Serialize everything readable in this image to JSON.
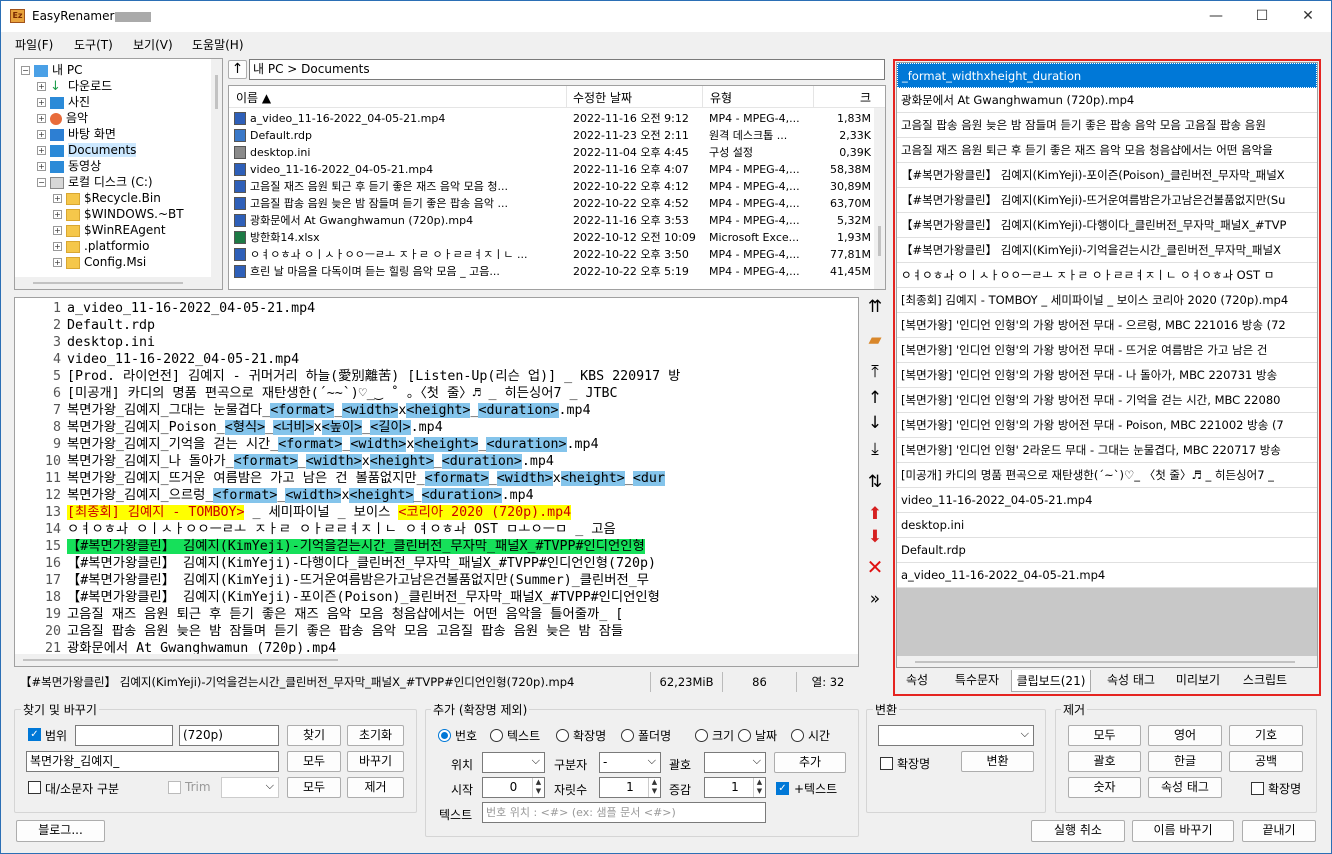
{
  "window": {
    "title": "EasyRenamer",
    "minimize": "—",
    "maximize": "☐",
    "close": "✕"
  },
  "menu": [
    "파일(F)",
    "도구(T)",
    "보기(V)",
    "도움말(H)"
  ],
  "tree": [
    {
      "label": "내 PC",
      "level": 0,
      "expanded": true
    },
    {
      "label": "다운로드",
      "level": 1
    },
    {
      "label": "사진",
      "level": 1
    },
    {
      "label": "음악",
      "level": 1
    },
    {
      "label": "바탕 화면",
      "level": 1
    },
    {
      "label": "Documents",
      "level": 1,
      "selected": true
    },
    {
      "label": "동영상",
      "level": 1
    },
    {
      "label": "로컬 디스크 (C:)",
      "level": 1,
      "expanded": true
    },
    {
      "label": "$Recycle.Bin",
      "level": 2
    },
    {
      "label": "$WINDOWS.~BT",
      "level": 2
    },
    {
      "label": "$WinREAgent",
      "level": 2
    },
    {
      "label": ".platformio",
      "level": 2
    },
    {
      "label": "Config.Msi",
      "level": 2
    }
  ],
  "address": {
    "up": "↑",
    "path": "내 PC > Documents"
  },
  "file_columns": [
    "이름 ▲",
    "수정한 날짜",
    "유형",
    "크"
  ],
  "files": [
    {
      "name": "a_video_11-16-2022_04-05-21.mp4",
      "date": "2022-11-16 오전 9:12",
      "type": "MP4 - MPEG-4,...",
      "size": "1,83M",
      "icon": "mp4"
    },
    {
      "name": "Default.rdp",
      "date": "2022-11-23 오전 2:11",
      "type": "원격 데스크톱 ...",
      "size": "2,33K",
      "icon": "rdp"
    },
    {
      "name": "desktop.ini",
      "date": "2022-11-04 오후 4:45",
      "type": "구성 설정",
      "size": "0,39K",
      "icon": "ini"
    },
    {
      "name": "video_11-16-2022_04-05-21.mp4",
      "date": "2022-11-16 오후 4:07",
      "type": "MP4 - MPEG-4,...",
      "size": "58,38M",
      "icon": "mp4"
    },
    {
      "name": "고음질 재즈 음원 퇴근 후 듣기 좋은 재즈 음악 모음 청...",
      "date": "2022-10-22 오후 4:12",
      "type": "MP4 - MPEG-4,...",
      "size": "30,89M",
      "icon": "mp4"
    },
    {
      "name": "고음질 팝송 음원 늦은 밤 잠들며 듣기 좋은 팝송 음악 ...",
      "date": "2022-10-22 오후 4:52",
      "type": "MP4 - MPEG-4,...",
      "size": "63,70M",
      "icon": "mp4"
    },
    {
      "name": "광화문에서 At Gwanghwamun (720p).mp4",
      "date": "2022-11-16 오후 3:53",
      "type": "MP4 - MPEG-4,...",
      "size": "5,32M",
      "icon": "mp4"
    },
    {
      "name": "방한화14.xlsx",
      "date": "2022-10-12 오전 10:09",
      "type": "Microsoft Exce...",
      "size": "1,93M",
      "icon": "xlsx"
    },
    {
      "name": "ㅇㅕㅇㅎㅘ ㅇㅣㅅㅏㅇㅇㅡㄹㅗ ㅈㅏㄹ ㅇㅏㄹㄹㅕㅈㅣㄴ ...",
      "date": "2022-10-22 오후 3:50",
      "type": "MP4 - MPEG-4,...",
      "size": "77,81M",
      "icon": "mp4"
    },
    {
      "name": "흐린 날 마음을 다독이며 듣는 힐링 음악 모음 _ 고음...",
      "date": "2022-10-22 오후 5:19",
      "type": "MP4 - MPEG-4,...",
      "size": "41,45M",
      "icon": "mp4"
    }
  ],
  "editor": [
    {
      "n": "1",
      "segs": [
        {
          "t": "a_video_11-16-2022_04-05-21.mp4",
          "h": ""
        }
      ]
    },
    {
      "n": "2",
      "segs": [
        {
          "t": "Default.rdp",
          "h": ""
        }
      ]
    },
    {
      "n": "3",
      "segs": [
        {
          "t": "desktop.ini",
          "h": ""
        }
      ]
    },
    {
      "n": "4",
      "segs": [
        {
          "t": "video_11-16-2022_04-05-21.mp4",
          "h": ""
        }
      ]
    },
    {
      "n": "5",
      "segs": [
        {
          "t": "[Prod. 라이언전] 김예지 - 귀머거리 하늘(愛別離苦) [Listen-Up(리슨 업)] _ KBS 220917 방",
          "h": ""
        }
      ]
    },
    {
      "n": "6",
      "segs": [
        {
          "t": "[미공개] 카디의 명품 편곡으로 재탄생한(´~~`)♡_‿ ˚ 。〈첫 줄〉♬ _ 히든싱어7 _ JTBC",
          "h": ""
        }
      ]
    },
    {
      "n": "7",
      "segs": [
        {
          "t": "복면가왕_김예지_그대는 눈물겹다_",
          "h": ""
        },
        {
          "t": "<format>",
          "h": "blue"
        },
        {
          "t": "_",
          "h": ""
        },
        {
          "t": "<width>",
          "h": "blue"
        },
        {
          "t": "x",
          "h": ""
        },
        {
          "t": "<height>",
          "h": "blue"
        },
        {
          "t": "_",
          "h": ""
        },
        {
          "t": "<duration>",
          "h": "blue"
        },
        {
          "t": ".mp4",
          "h": ""
        }
      ]
    },
    {
      "n": "8",
      "segs": [
        {
          "t": "복면가왕_김예지_Poison_",
          "h": ""
        },
        {
          "t": "<형식>",
          "h": "blue"
        },
        {
          "t": "_",
          "h": ""
        },
        {
          "t": "<너비>",
          "h": "blue"
        },
        {
          "t": "x",
          "h": ""
        },
        {
          "t": "<높이>",
          "h": "blue"
        },
        {
          "t": "_",
          "h": ""
        },
        {
          "t": "<길이>",
          "h": "blue"
        },
        {
          "t": ".mp4",
          "h": ""
        }
      ]
    },
    {
      "n": "9",
      "segs": [
        {
          "t": "복면가왕_김예지_기억을 걷는 시간_",
          "h": ""
        },
        {
          "t": "<format>",
          "h": "blue"
        },
        {
          "t": "_",
          "h": ""
        },
        {
          "t": "<width>",
          "h": "blue"
        },
        {
          "t": "x",
          "h": ""
        },
        {
          "t": "<height>",
          "h": "blue"
        },
        {
          "t": "_",
          "h": ""
        },
        {
          "t": "<duration>",
          "h": "blue"
        },
        {
          "t": ".mp4",
          "h": ""
        }
      ]
    },
    {
      "n": "10",
      "segs": [
        {
          "t": "복면가왕_김예지_나 돌아가_",
          "h": ""
        },
        {
          "t": "<format>",
          "h": "blue"
        },
        {
          "t": "_",
          "h": ""
        },
        {
          "t": "<width>",
          "h": "blue"
        },
        {
          "t": "x",
          "h": ""
        },
        {
          "t": "<height>",
          "h": "blue"
        },
        {
          "t": "_",
          "h": ""
        },
        {
          "t": "<duration>",
          "h": "blue"
        },
        {
          "t": ".mp4",
          "h": ""
        }
      ]
    },
    {
      "n": "11",
      "segs": [
        {
          "t": "복면가왕_김예지_뜨거운 여름밤은 가고 남은 건 볼품없지만_",
          "h": ""
        },
        {
          "t": "<format>",
          "h": "blue"
        },
        {
          "t": "_",
          "h": ""
        },
        {
          "t": "<width>",
          "h": "blue"
        },
        {
          "t": "x",
          "h": ""
        },
        {
          "t": "<height>",
          "h": "blue"
        },
        {
          "t": "_",
          "h": ""
        },
        {
          "t": "<dur",
          "h": "blue"
        }
      ]
    },
    {
      "n": "12",
      "segs": [
        {
          "t": "복면가왕_김예지_으르렁_",
          "h": ""
        },
        {
          "t": "<format>",
          "h": "blue"
        },
        {
          "t": "_",
          "h": ""
        },
        {
          "t": "<width>",
          "h": "blue"
        },
        {
          "t": "x",
          "h": ""
        },
        {
          "t": "<height>",
          "h": "blue"
        },
        {
          "t": "_",
          "h": ""
        },
        {
          "t": "<duration>",
          "h": "blue"
        },
        {
          "t": ".mp4",
          "h": ""
        }
      ]
    },
    {
      "n": "13",
      "segs": [
        {
          "t": "[최종회] 김예지 - TOMBOY>",
          "h": "yellow"
        },
        {
          "t": " _ 세미파이널 _ 보이스 ",
          "h": ""
        },
        {
          "t": "<코리아 2020 (720p).mp4",
          "h": "yellow"
        }
      ]
    },
    {
      "n": "14",
      "segs": [
        {
          "t": "ㅇㅕㅇㅎㅘ ㅇㅣㅅㅏㅇㅇㅡㄹㅗ ㅈㅏㄹ ㅇㅏㄹㄹㅕㅈㅣㄴ ㅇㅕㅇㅎㅘ OST ㅁㅗㅇㅡㅁ _ 고음",
          "h": ""
        }
      ]
    },
    {
      "n": "15",
      "segs": [
        {
          "t": "【#복면가왕클린】 김예지(KimYeji)-기억을걷는시간_클린버전_무자막_패널X_#TVPP#인디언인형",
          "h": "green"
        }
      ]
    },
    {
      "n": "16",
      "segs": [
        {
          "t": "【#복면가왕클린】 김예지(KimYeji)-다행이다_클린버전_무자막_패널X_#TVPP#인디언인형(720p)",
          "h": ""
        }
      ]
    },
    {
      "n": "17",
      "segs": [
        {
          "t": "【#복면가왕클린】 김예지(KimYeji)-뜨거운여름밤은가고남은건볼품없지만(Summer)_클린버전_무",
          "h": ""
        }
      ]
    },
    {
      "n": "18",
      "segs": [
        {
          "t": "【#복면가왕클린】 김예지(KimYeji)-포이즌(Poison)_클린버전_무자막_패널X_#TVPP#인디언인형",
          "h": ""
        }
      ]
    },
    {
      "n": "19",
      "segs": [
        {
          "t": "고음질 재즈 음원 퇴근 후 듣기 좋은 재즈 음악 모음 청음샵에서는 어떤 음악을 틀어줄까_ [",
          "h": ""
        }
      ]
    },
    {
      "n": "20",
      "segs": [
        {
          "t": "고음질 팝송 음원 늦은 밤 잠들며 듣기 좋은 팝송 음악 모음 고음질 팝송 음원 늦은 밤 잠들",
          "h": ""
        }
      ]
    },
    {
      "n": "21",
      "segs": [
        {
          "t": "광화문에서 At Gwanghwamun (720p).mp4",
          "h": ""
        }
      ]
    }
  ],
  "status": {
    "filename": "【#복면가왕클린】 김예지(KimYeji)-기억을걷는시간_클린버전_무자막_패널X_#TVPP#인디언인형(720p).mp4",
    "size": "62,23MiB",
    "count": "86",
    "col": "열: 32"
  },
  "right_list": [
    "_format_widthxheight_duration",
    "광화문에서 At Gwanghwamun (720p).mp4",
    "고음질 팝송 음원 늦은 밤 잠들며 듣기 좋은 팝송 음악 모음 고음질 팝송 음원",
    "고음질 재즈 음원 퇴근 후 듣기 좋은 재즈 음악 모음 청음샵에서는 어떤 음악을",
    "【#복면가왕클린】 김예지(KimYeji)-포이즌(Poison)_클린버전_무자막_패널X",
    "【#복면가왕클린】 김예지(KimYeji)-뜨거운여름밤은가고남은건볼품없지만(Su",
    "【#복면가왕클린】 김예지(KimYeji)-다행이다_클린버전_무자막_패널X_#TVP",
    "【#복면가왕클린】 김예지(KimYeji)-기억을걷는시간_클린버전_무자막_패널X",
    "ㅇㅕㅇㅎㅘ ㅇㅣㅅㅏㅇㅇㅡㄹㅗ ㅈㅏㄹ ㅇㅏㄹㄹㅕㅈㅣㄴ ㅇㅕㅇㅎㅘ OST ㅁ",
    "[최종회] 김예지 - TOMBOY _ 세미파이널 _ 보이스 코리아 2020 (720p).mp4",
    "[복면가왕] '인디언 인형'의 가왕 방어전 무대 - 으르렁, MBC 221016 방송 (72",
    "[복면가왕] '인디언 인형'의 가왕 방어전 무대 - 뜨거운 여름밤은 가고 남은 건",
    "[복면가왕] '인디언 인형'의 가왕 방어전 무대 - 나 돌아가, MBC 220731 방송",
    "[복면가왕] '인디언 인형'의 가왕 방어전 무대 - 기억을 걷는 시간, MBC 22080",
    "[복면가왕] '인디언 인형'의 가왕 방어전 무대 - Poison, MBC 221002 방송 (7",
    "[복면가왕] '인디언 인형' 2라운드 무대 - 그대는 눈물겹다, MBC 220717 방송",
    "[미공개] 카디의 명품 편곡으로 재탄생한(´~`)♡_ 〈첫 줄〉♬ _ 히든싱어7 _",
    "video_11-16-2022_04-05-21.mp4",
    "desktop.ini",
    "Default.rdp",
    "a_video_11-16-2022_04-05-21.mp4"
  ],
  "tabs": [
    "속성",
    "특수문자",
    "클립보드(21)",
    "속성 태그",
    "미리보기",
    "스크립트"
  ],
  "find": {
    "title": "찾기 및 바꾸기",
    "range_label": "범위",
    "range_value": "(720p)",
    "find_btn": "찾기",
    "reset_btn": "초기화",
    "replace_value": "복면가왕_김예지_",
    "all_btn": "모두",
    "replace_btn": "바꾸기",
    "case_label": "대/소문자 구분",
    "trim_label": "Trim",
    "all2_btn": "모두",
    "remove_btn": "제거"
  },
  "add": {
    "title": "추가 (확장명 제외)",
    "radios": [
      "번호",
      "텍스트",
      "확장명",
      "폴더명",
      "크기",
      "날짜",
      "시간"
    ],
    "pos_label": "위치",
    "sep_label": "구분자",
    "sep_value": "-",
    "bracket_label": "괄호",
    "add_btn": "추가",
    "start_label": "시작",
    "start_value": "0",
    "digits_label": "자릿수",
    "digits_value": "1",
    "step_label": "증감",
    "step_value": "1",
    "plus_text_label": "+텍스트",
    "text_label": "텍스트",
    "text_placeholder": "번호 위치 : <#> (ex: 샘플 문서 <#>)"
  },
  "convert": {
    "title": "변환",
    "ext_label": "확장명",
    "convert_btn": "변환"
  },
  "remove": {
    "title": "제거",
    "buttons": [
      "모두",
      "영어",
      "기호",
      "괄호",
      "한글",
      "공백",
      "숫자",
      "속성 태그"
    ],
    "ext_label": "확장명"
  },
  "footer": {
    "blog_btn": "블로그...",
    "undo_btn": "실행 취소",
    "rename_btn": "이름 바꾸기",
    "exit_btn": "끝내기"
  }
}
